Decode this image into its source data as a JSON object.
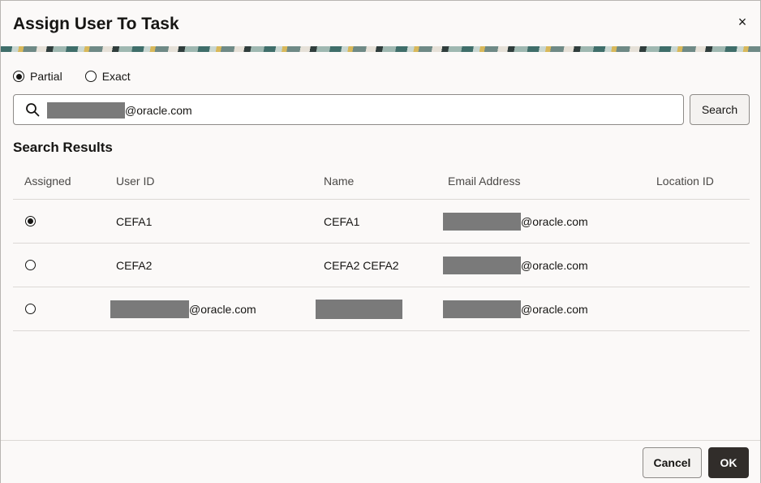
{
  "dialog": {
    "title": "Assign User To Task",
    "close_glyph": "×"
  },
  "search_mode": {
    "options": [
      {
        "label": "Partial",
        "checked": true
      },
      {
        "label": "Exact",
        "checked": false
      }
    ]
  },
  "search": {
    "value_suffix": "@oracle.com",
    "button_label": "Search",
    "icon": "search-icon"
  },
  "results": {
    "heading": "Search Results",
    "columns": [
      "Assigned",
      "User ID",
      "Name",
      "Email Address",
      "Location ID"
    ],
    "rows": [
      {
        "assigned": true,
        "user_id": "CEFA1",
        "user_id_redacted": false,
        "name": "CEFA1",
        "name_redacted": false,
        "email_suffix": "@oracle.com",
        "location_id": ""
      },
      {
        "assigned": false,
        "user_id": "CEFA2",
        "user_id_redacted": false,
        "name": "CEFA2 CEFA2",
        "name_redacted": false,
        "email_suffix": "@oracle.com",
        "location_id": ""
      },
      {
        "assigned": false,
        "user_id": "@oracle.com",
        "user_id_redacted": true,
        "name": "",
        "name_redacted": true,
        "email_suffix": "@oracle.com",
        "location_id": ""
      }
    ]
  },
  "footer": {
    "cancel_label": "Cancel",
    "ok_label": "OK"
  },
  "colors": {
    "dialog_bg": "#fbf9f8",
    "primary_button": "#312d2a",
    "redaction": "#7a7a7a"
  }
}
